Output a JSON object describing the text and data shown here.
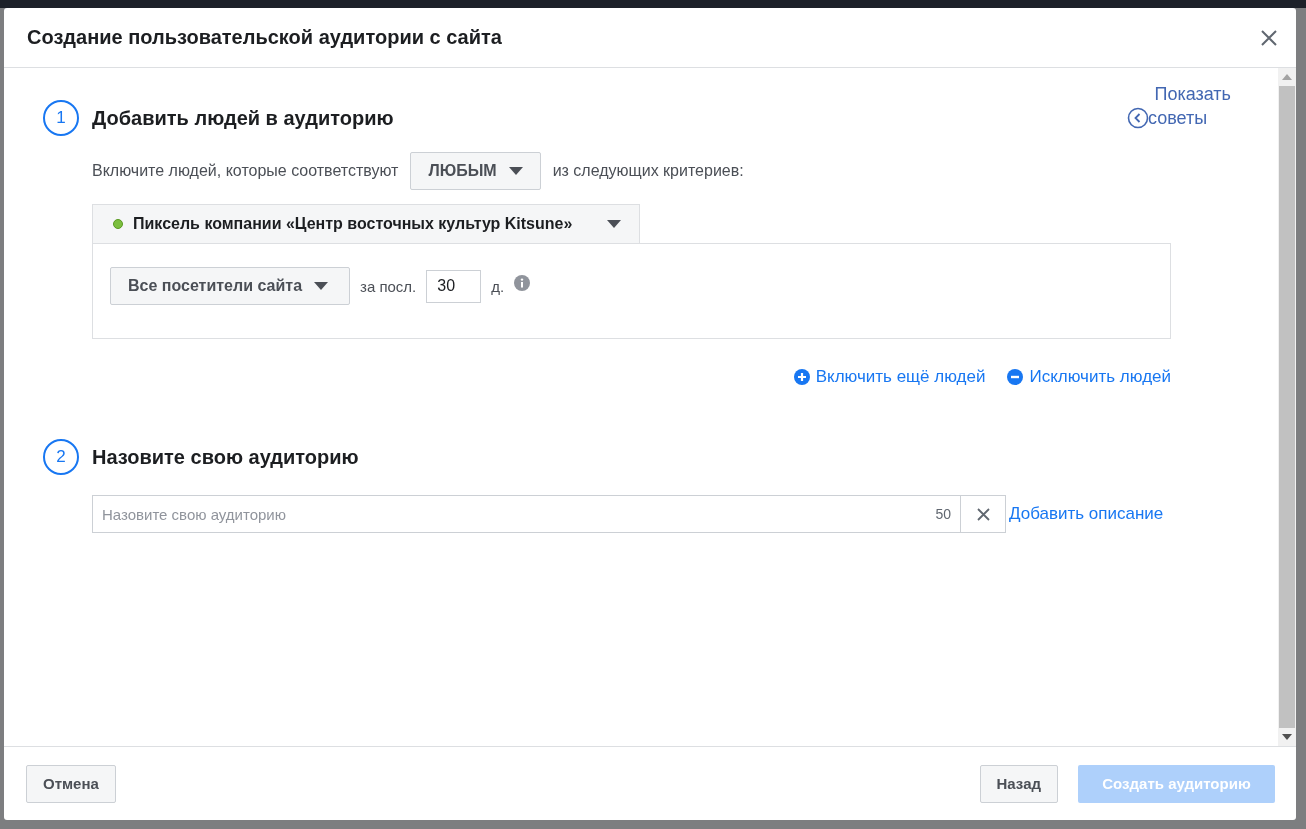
{
  "dialog": {
    "title": "Создание пользовательской аудитории с сайта"
  },
  "tips_link": {
    "line_1": "Показать",
    "line_2": "советы"
  },
  "steps": [
    {
      "number": "1",
      "title": "Добавить людей в аудиторию"
    },
    {
      "number": "2",
      "title": "Назовите свою аудиторию"
    }
  ],
  "match_rule": {
    "prefix": "Включите людей, которые соответствуют",
    "value": "ЛЮБЫМ",
    "suffix": "из следующих критериев:"
  },
  "pixel": {
    "label": "Пиксель компании «Центр восточных культур Kitsune»",
    "active": true
  },
  "criteria": {
    "event": "Все посетители сайта",
    "period_label": "за посл.",
    "days": "30",
    "unit": "д."
  },
  "criteria_links": [
    {
      "label": "Включить ещё людей",
      "kind": "include"
    },
    {
      "label": "Исключить людей",
      "kind": "exclude"
    }
  ],
  "name_field": {
    "placeholder": "Назовите свою аудиторию",
    "counter": "50"
  },
  "add_description": "Добавить описание",
  "footer": {
    "cancel": "Отмена",
    "back": "Назад",
    "create": {
      "label": "Создать аудиторию",
      "disabled": true
    }
  }
}
